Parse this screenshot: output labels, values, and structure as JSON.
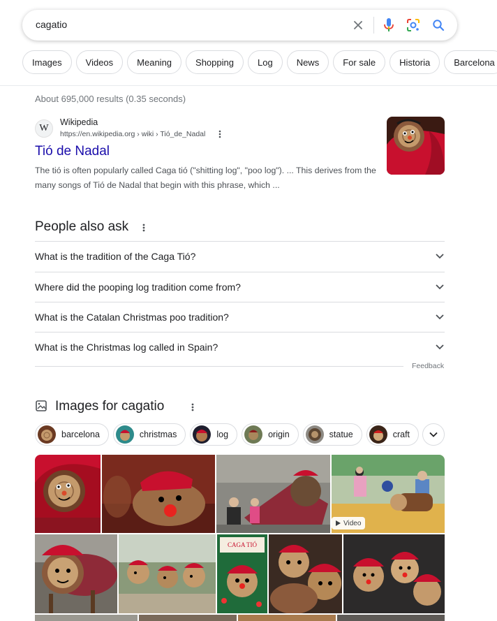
{
  "search": {
    "query": "cagatio"
  },
  "chips": [
    "Images",
    "Videos",
    "Meaning",
    "Shopping",
    "Log",
    "News",
    "For sale",
    "Historia",
    "Barcelona"
  ],
  "stats": "About 695,000 results (0.35 seconds)",
  "result": {
    "site_name": "Wikipedia",
    "url": "https://en.wikipedia.org › wiki › Tió_de_Nadal",
    "favicon_letter": "W",
    "title": "Tió de Nadal",
    "snippet": "The tió is often popularly called Caga tió (\"shitting log\", \"poo log\"). ... This derives from the many songs of Tió de Nadal that begin with this phrase, which ..."
  },
  "paa": {
    "title": "People also ask",
    "questions": [
      "What is the tradition of the Caga Tió?",
      "Where did the pooping log tradition come from?",
      "What is the Catalan Christmas poo tradition?",
      "What is the Christmas log called in Spain?"
    ],
    "feedback": "Feedback"
  },
  "images": {
    "title": "Images for cagatio",
    "chips": [
      "barcelona",
      "christmas",
      "log",
      "origin",
      "statue",
      "craft"
    ],
    "video_label": "Video",
    "caga_tio_sign": "CAGA TIÓ"
  },
  "colors": {
    "link": "#1a0dab",
    "google_blue": "#4285f4",
    "google_red": "#ea4335",
    "google_yellow": "#fbbc04",
    "google_green": "#34a853"
  }
}
